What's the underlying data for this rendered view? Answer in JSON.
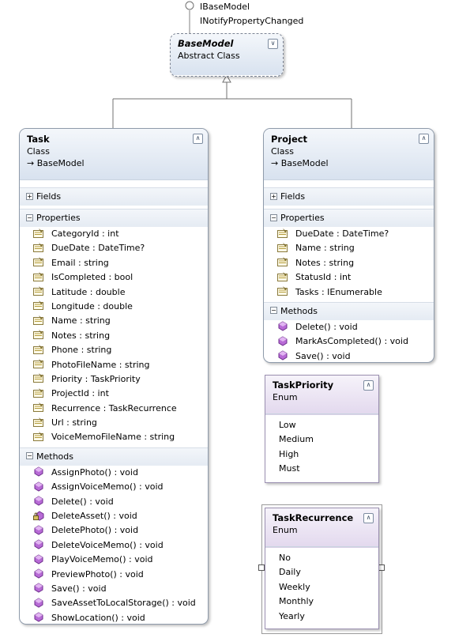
{
  "interfaces": [
    "IBaseModel",
    "INotifyPropertyChanged"
  ],
  "base_model": {
    "name": "BaseModel",
    "type": "Abstract Class"
  },
  "task": {
    "name": "Task",
    "type": "Class",
    "base": "BaseModel",
    "fields_label": "Fields",
    "properties_label": "Properties",
    "methods_label": "Methods",
    "properties": [
      "CategoryId : int",
      "DueDate : DateTime?",
      "Email : string",
      "IsCompleted : bool",
      "Latitude : double",
      "Longitude : double",
      "Name : string",
      "Notes : string",
      "Phone : string",
      "PhotoFileName : string",
      "Priority : TaskPriority",
      "ProjectId : int",
      "Recurrence : TaskRecurrence",
      "Url : string",
      "VoiceMemoFileName : string"
    ],
    "methods": [
      "AssignPhoto() : void",
      "AssignVoiceMemo() : void",
      "Delete() : void",
      "DeleteAsset() : void",
      "DeletePhoto() : void",
      "DeleteVoiceMemo() : void",
      "PlayVoiceMemo() : void",
      "PreviewPhoto() : void",
      "Save() : void",
      "SaveAssetToLocalStorage() : void",
      "ShowLocation() : void"
    ]
  },
  "project": {
    "name": "Project",
    "type": "Class",
    "base": "BaseModel",
    "fields_label": "Fields",
    "properties_label": "Properties",
    "methods_label": "Methods",
    "properties": [
      "DueDate : DateTime?",
      "Name : string",
      "Notes : string",
      "StatusId : int",
      "Tasks : IEnumerable"
    ],
    "methods": [
      "Delete() : void",
      "MarkAsCompleted() : void",
      "Save() : void"
    ]
  },
  "task_priority": {
    "name": "TaskPriority",
    "type": "Enum",
    "values": [
      "Low",
      "Medium",
      "High",
      "Must"
    ]
  },
  "task_recurrence": {
    "name": "TaskRecurrence",
    "type": "Enum",
    "values": [
      "No",
      "Daily",
      "Weekly",
      "Monthly",
      "Yearly"
    ]
  }
}
